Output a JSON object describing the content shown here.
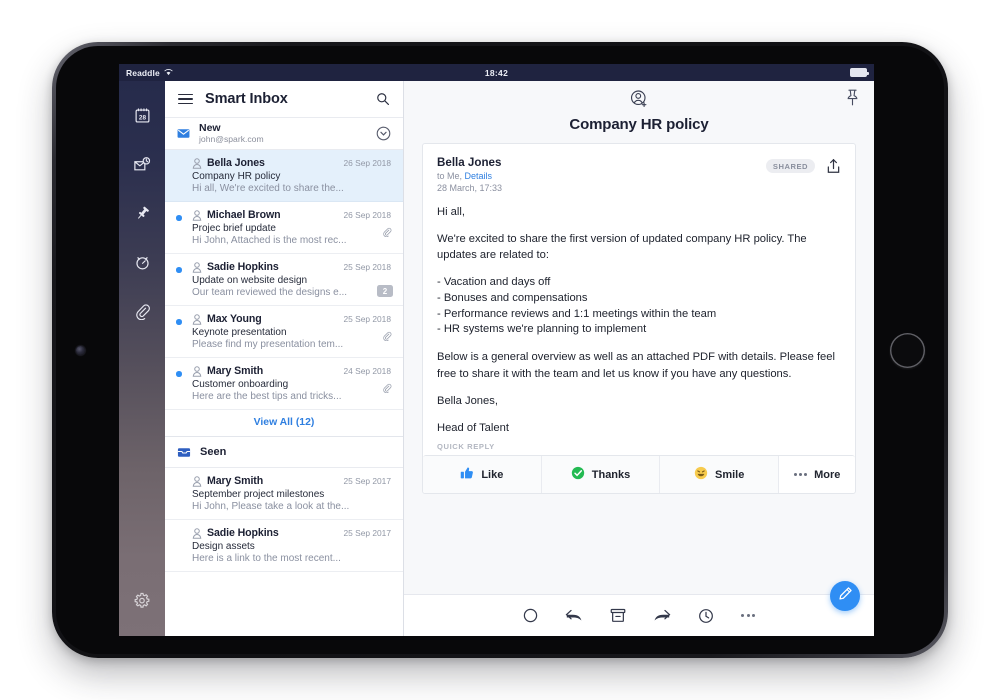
{
  "statusbar": {
    "carrier": "Readdle",
    "wifi_icon": "wifi-icon",
    "time": "18:42",
    "battery_icon": "battery-icon"
  },
  "rail": {
    "items": [
      {
        "name": "calendar",
        "icon": "calendar-28-icon",
        "label": "Calendar"
      },
      {
        "name": "inbox-pending",
        "icon": "inbox-clock-icon",
        "label": "Pending"
      },
      {
        "name": "pinned",
        "icon": "pin-icon",
        "label": "Pinned"
      },
      {
        "name": "snoozed",
        "icon": "alarm-clock-icon",
        "label": "Snoozed"
      },
      {
        "name": "attachments",
        "icon": "paperclip-icon",
        "label": "Attachments"
      }
    ],
    "settings": {
      "name": "settings",
      "icon": "gear-icon",
      "label": "Settings"
    }
  },
  "list_header": {
    "menu_icon": "hamburger-icon",
    "title": "Smart Inbox",
    "search_icon": "search-icon"
  },
  "account": {
    "envelope_icon": "envelope-icon",
    "name": "New",
    "email": "john@spark.com",
    "chevron_icon": "chevron-down-circle-icon"
  },
  "sections": [
    {
      "id": "new",
      "messages": [
        {
          "sender": "Bella Jones",
          "date": "26 Sep 2018",
          "subject": "Company HR policy",
          "preview": "Hi all, We're excited to share the...",
          "unread": false,
          "selected": true,
          "attachment": false,
          "count": ""
        },
        {
          "sender": "Michael Brown",
          "date": "26 Sep 2018",
          "subject": "Projec brief update",
          "preview": "Hi John, Attached is the most rec...",
          "unread": true,
          "selected": false,
          "attachment": true,
          "count": ""
        },
        {
          "sender": "Sadie Hopkins",
          "date": "25 Sep 2018",
          "subject": "Update on website design",
          "preview": "Our team reviewed the designs e...",
          "unread": true,
          "selected": false,
          "attachment": false,
          "count": "2"
        },
        {
          "sender": "Max Young",
          "date": "25 Sep 2018",
          "subject": "Keynote presentation",
          "preview": "Please find my presentation tem...",
          "unread": true,
          "selected": false,
          "attachment": true,
          "count": ""
        },
        {
          "sender": "Mary Smith",
          "date": "24 Sep 2018",
          "subject": "Customer onboarding",
          "preview": "Here are the best tips and tricks...",
          "unread": true,
          "selected": false,
          "attachment": true,
          "count": ""
        }
      ],
      "view_all": "View All (12)"
    },
    {
      "id": "seen",
      "header_label": "Seen",
      "header_icon": "inbox-tray-icon",
      "messages": [
        {
          "sender": "Mary Smith",
          "date": "25 Sep 2017",
          "subject": "September project milestones",
          "preview": "Hi John, Please take a look at the...",
          "unread": false,
          "selected": false,
          "attachment": false,
          "count": ""
        },
        {
          "sender": "Sadie Hopkins",
          "date": "25 Sep 2017",
          "subject": "Design assets",
          "preview": "Here is a link to the most recent...",
          "unread": false,
          "selected": false,
          "attachment": false,
          "count": ""
        }
      ]
    }
  ],
  "reader": {
    "add_contact_icon": "add-person-icon",
    "title": "Company HR policy",
    "pin_icon": "pin-icon",
    "message": {
      "sender": "Bella Jones",
      "to_prefix": "to Me,",
      "details_link": "Details",
      "timestamp": "28 March, 17:33",
      "shared_badge": "SHARED",
      "share_icon": "share-upload-icon",
      "greeting": "Hi all,",
      "intro": "We're excited to share the first version of updated company HR policy. The updates are related to:",
      "bullets": [
        "- Vacation and days off",
        "- Bonuses and compensations",
        "- Performance reviews and 1:1 meetings within the team",
        "- HR systems we're planning to implement"
      ],
      "outro": "Below is a general overview as well as an attached PDF with details. Please feel free to share it with the team and let us know if you have any questions.",
      "signoff": "Bella Jones,",
      "role": "Head of Talent"
    },
    "quick_reply": {
      "label": "QUICK REPLY",
      "buttons": [
        {
          "label": "Like",
          "icon": "thumbs-up-icon"
        },
        {
          "label": "Thanks",
          "icon": "check-circle-icon"
        },
        {
          "label": "Smile",
          "icon": "smile-emoji-icon"
        },
        {
          "label": "More",
          "icon": "ellipsis-icon"
        }
      ]
    }
  },
  "toolbar": {
    "items": [
      {
        "name": "mark-unread",
        "icon": "circle-outline-icon"
      },
      {
        "name": "reply",
        "icon": "reply-arrow-icon"
      },
      {
        "name": "archive",
        "icon": "archive-box-icon"
      },
      {
        "name": "forward",
        "icon": "forward-arrow-icon"
      },
      {
        "name": "snooze",
        "icon": "clock-icon"
      },
      {
        "name": "more",
        "icon": "ellipsis-icon"
      }
    ],
    "compose": {
      "name": "compose",
      "icon": "pencil-icon"
    }
  },
  "colors": {
    "accent_blue": "#2f8ef4",
    "link_blue": "#2f7fe0",
    "status_bar": "#1f2340",
    "selected_row": "#e4f0fb",
    "rail_top": "#262b4b",
    "rail_bottom": "#7d7177",
    "green_check": "#23ba52",
    "smile_yellow": "#f7cb4d"
  }
}
